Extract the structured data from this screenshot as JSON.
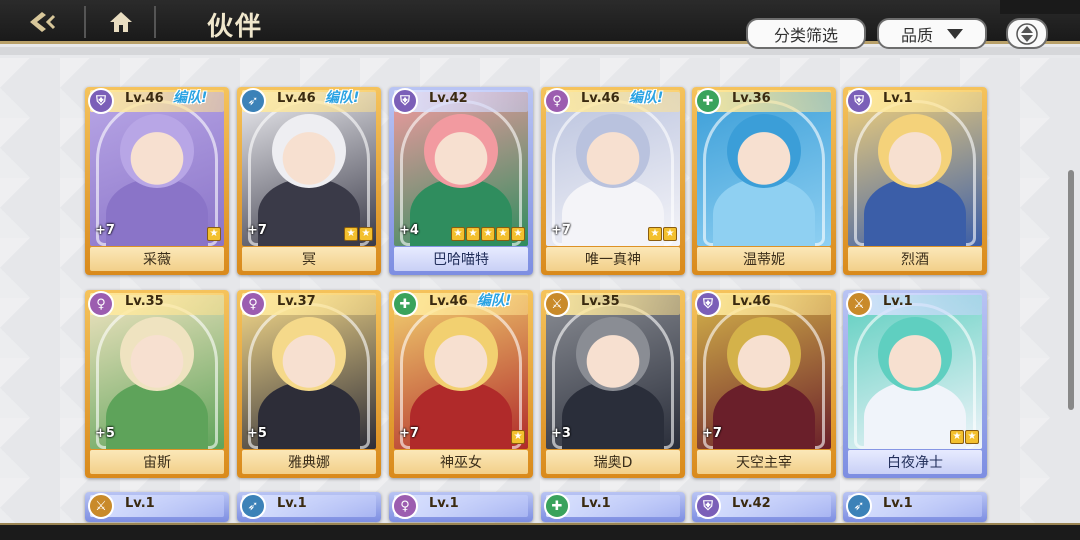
{
  "header": {
    "title": "伙伴"
  },
  "toolbar": {
    "filter_label": "分类筛选",
    "sort_label": "品质"
  },
  "colors": {
    "gold_card": "#e4a12e",
    "blue_card": "#8f9ee6",
    "team_label": "#2aa3e3",
    "topbar": "#222222",
    "accent_border": "#b9a16a"
  },
  "cards": [
    {
      "name": "采薇",
      "level": "Lv.46",
      "team": "编队!",
      "plus": "+7",
      "stars": 1,
      "frame": "gold",
      "class_icon": "shield-icon",
      "class_color": "#7b5fb8",
      "palette": [
        "#b8a6e6",
        "#8a74c8"
      ]
    },
    {
      "name": "冥",
      "level": "Lv.46",
      "team": "编队!",
      "plus": "+7",
      "stars": 2,
      "frame": "gold",
      "class_icon": "bow-icon",
      "class_color": "#3c82b8",
      "palette": [
        "#eeeef2",
        "#3a3a48"
      ]
    },
    {
      "name": "巴哈喵特",
      "level": "Lv.42",
      "team": "",
      "plus": "+4",
      "stars": 5,
      "frame": "blue",
      "class_icon": "shield-icon",
      "class_color": "#7b5fb8",
      "palette": [
        "#f29aa0",
        "#2f8d5e"
      ]
    },
    {
      "name": "唯一真神",
      "level": "Lv.46",
      "team": "编队!",
      "plus": "+7",
      "stars": 2,
      "frame": "gold",
      "class_icon": "female-icon",
      "class_color": "#9c5db0",
      "palette": [
        "#b9c2de",
        "#f4f4f8"
      ]
    },
    {
      "name": "温蒂妮",
      "level": "Lv.36",
      "team": "",
      "plus": "",
      "stars": 0,
      "frame": "gold",
      "class_icon": "cross-icon",
      "class_color": "#3aa35c",
      "palette": [
        "#3b9ed8",
        "#8fd0f2"
      ]
    },
    {
      "name": "烈酒",
      "level": "Lv.1",
      "team": "",
      "plus": "",
      "stars": 0,
      "frame": "gold",
      "class_icon": "shield-icon",
      "class_color": "#7b5fb8",
      "palette": [
        "#f4d27a",
        "#3b5ea8"
      ]
    },
    {
      "name": "宙斯",
      "level": "Lv.35",
      "team": "",
      "plus": "+5",
      "stars": 0,
      "frame": "gold",
      "class_icon": "female-icon",
      "class_color": "#9c5db0",
      "palette": [
        "#efe3c0",
        "#5ea35a"
      ]
    },
    {
      "name": "雅典娜",
      "level": "Lv.37",
      "team": "",
      "plus": "+5",
      "stars": 0,
      "frame": "gold",
      "class_icon": "female-icon",
      "class_color": "#9c5db0",
      "palette": [
        "#f5d98a",
        "#2d2d38"
      ]
    },
    {
      "name": "神巫女",
      "level": "Lv.46",
      "team": "编队!",
      "plus": "+7",
      "stars": 1,
      "frame": "gold",
      "class_icon": "cross-icon",
      "class_color": "#3aa35c",
      "palette": [
        "#f2d070",
        "#b02a2a"
      ]
    },
    {
      "name": "瑞奥D",
      "level": "Lv.35",
      "team": "",
      "plus": "+3",
      "stars": 0,
      "frame": "gold",
      "class_icon": "sword-icon",
      "class_color": "#c98a2a",
      "palette": [
        "#8a8d94",
        "#2a2e3a"
      ]
    },
    {
      "name": "天空主宰",
      "level": "Lv.46",
      "team": "",
      "plus": "+7",
      "stars": 0,
      "frame": "gold",
      "class_icon": "shield-icon",
      "class_color": "#7b5fb8",
      "palette": [
        "#d4b24a",
        "#6a1f2a"
      ]
    },
    {
      "name": "白夜净士",
      "level": "Lv.1",
      "team": "",
      "plus": "",
      "stars": 2,
      "frame": "blue",
      "class_icon": "sword-icon",
      "class_color": "#c98a2a",
      "palette": [
        "#5fcfc0",
        "#f0f4fa"
      ]
    }
  ],
  "partial_row": [
    {
      "level": "Lv.1",
      "frame": "blue",
      "class_icon": "sword-icon",
      "class_color": "#c98a2a"
    },
    {
      "level": "Lv.1",
      "frame": "blue",
      "class_icon": "bow-icon",
      "class_color": "#3c82b8"
    },
    {
      "level": "Lv.1",
      "frame": "blue",
      "class_icon": "female-icon",
      "class_color": "#9c5db0"
    },
    {
      "level": "Lv.1",
      "frame": "blue",
      "class_icon": "cross-icon",
      "class_color": "#3aa35c"
    },
    {
      "level": "Lv.42",
      "frame": "blue",
      "class_icon": "shield-icon",
      "class_color": "#7b5fb8"
    },
    {
      "level": "Lv.1",
      "frame": "blue",
      "class_icon": "bow-icon",
      "class_color": "#3c82b8"
    }
  ]
}
